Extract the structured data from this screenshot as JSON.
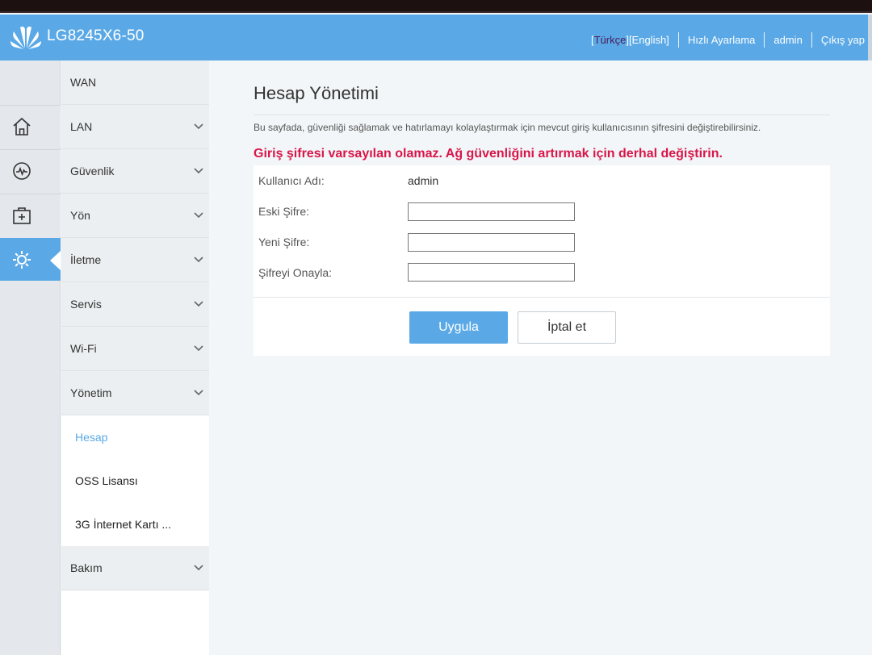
{
  "header": {
    "model": "LG8245X6-50",
    "lang_open": "[",
    "lang_turkish": "Türkçe",
    "lang_close": "]",
    "lang_english": "[English]",
    "quick_setup": "Hızlı Ayarlama",
    "user": "admin",
    "logout": "Çıkış yap",
    "colors": {
      "header_bg": "#5aa9e6",
      "active_lang": "#4a1a5a"
    }
  },
  "icon_sidebar": {
    "items": [
      {
        "icon": "home-icon"
      },
      {
        "icon": "status-monitor-icon"
      },
      {
        "icon": "toolbox-icon"
      },
      {
        "icon": "gear-icon",
        "active": true
      }
    ]
  },
  "menu": {
    "items": [
      {
        "label": "WAN"
      },
      {
        "label": "LAN"
      },
      {
        "label": "Güvenlik"
      },
      {
        "label": "Yön"
      },
      {
        "label": "İletme"
      },
      {
        "label": "Servis"
      },
      {
        "label": "Wi-Fi"
      },
      {
        "label": "Yönetim"
      }
    ],
    "subitems": [
      {
        "label": "Hesap",
        "active": true
      },
      {
        "label": "OSS Lisansı"
      },
      {
        "label": "3G İnternet Kartı ..."
      }
    ],
    "after": [
      {
        "label": "Bakım"
      }
    ]
  },
  "main": {
    "title": "Hesap Yönetimi",
    "description": "Bu sayfada, güvenliği sağlamak ve hatırlamayı kolaylaştırmak için mevcut giriş kullanıcısının şifresini değiştirebilirsiniz.",
    "warning": "Giriş şifresi varsayılan olamaz. Ağ güvenliğini artırmak için derhal değiştirin.",
    "warning_color": "#d8164a",
    "form": {
      "username_label": "Kullanıcı Adı:",
      "username_value": "admin",
      "old_password_label": "Eski Şifre:",
      "old_password_value": "",
      "new_password_label": "Yeni Şifre:",
      "new_password_value": "",
      "confirm_password_label": "Şifreyi Onayla:",
      "confirm_password_value": ""
    },
    "apply_label": "Uygula",
    "cancel_label": "İptal et"
  }
}
